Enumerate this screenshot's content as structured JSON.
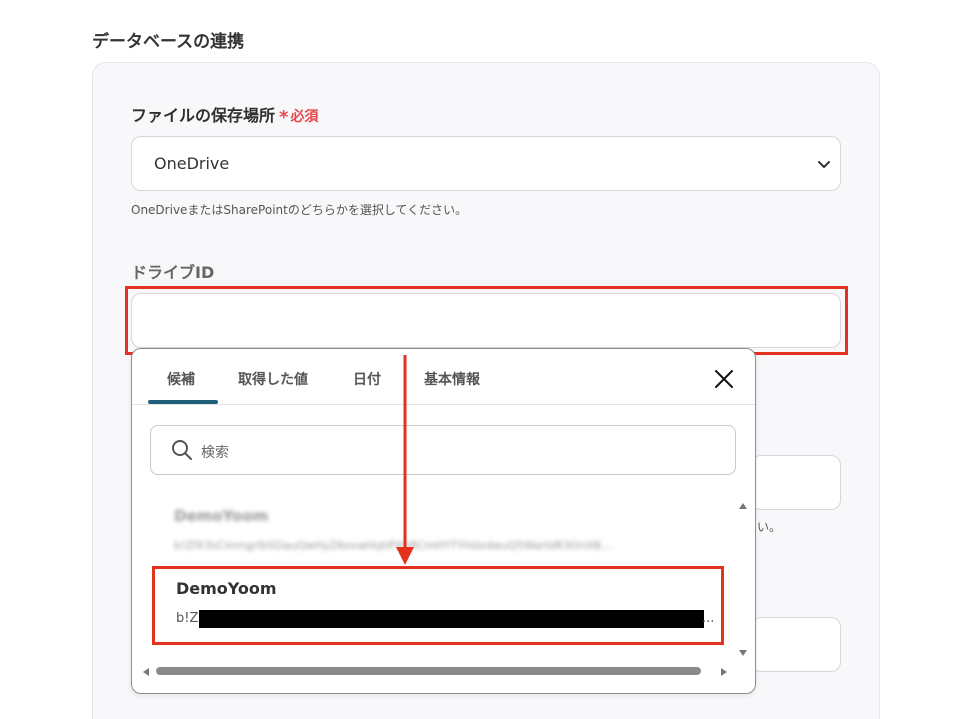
{
  "section": {
    "title": "データベースの連携"
  },
  "file_location": {
    "label": "ファイルの保存場所",
    "required_mark": "*",
    "required_text": "必須",
    "selected": "OneDrive",
    "help": "OneDriveまたはSharePointのどちらかを選択してください。"
  },
  "drive_id": {
    "label": "ドライブID",
    "value": ""
  },
  "background": {
    "help_fragment": "い。"
  },
  "dropdown": {
    "tabs": [
      "候補",
      "取得した値",
      "日付",
      "基本情報"
    ],
    "active_tab": "候補",
    "search_placeholder": "検索",
    "items": [
      {
        "title": "DemoYoom",
        "subtitle": "b!ZfX3sCmmgrIbSDauQwHyZ6evwHqhPXbRCmHYTYHdxdwuQ5WarIdR3OnXB...",
        "blurred": true
      },
      {
        "title": "DemoYoom",
        "subtitle_prefix": "b!Z",
        "subtitle_suffix": "...",
        "redacted": true,
        "highlighted": true
      }
    ]
  },
  "colors": {
    "highlight": "#e5321f",
    "required": "#e5484d",
    "tab_active": "#1f5f7a"
  }
}
